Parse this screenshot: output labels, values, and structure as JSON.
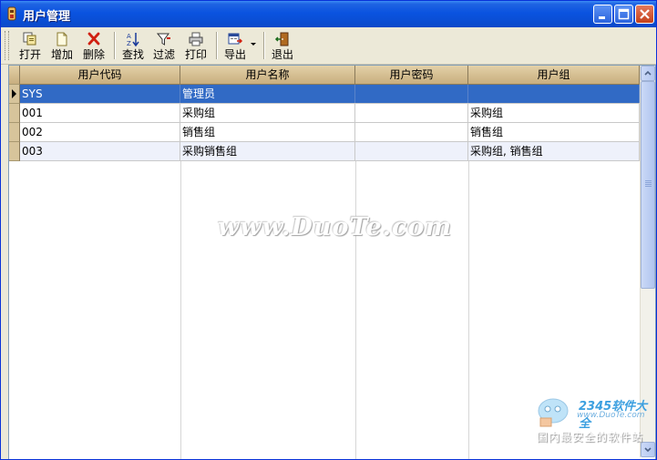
{
  "window": {
    "title": "用户管理"
  },
  "toolbar": {
    "open": "打开",
    "add": "增加",
    "delete": "删除",
    "find": "查找",
    "filter": "过滤",
    "print": "打印",
    "export": "导出",
    "exit": "退出"
  },
  "grid": {
    "columns": [
      "用户代码",
      "用户名称",
      "用户密码",
      "用户组"
    ],
    "rows": [
      {
        "code": "SYS",
        "name": "管理员",
        "password": "",
        "group": ""
      },
      {
        "code": "001",
        "name": "采购组",
        "password": "",
        "group": "采购组"
      },
      {
        "code": "002",
        "name": "销售组",
        "password": "",
        "group": "销售组"
      },
      {
        "code": "003",
        "name": "采购销售组",
        "password": "",
        "group": "采购组, 销售组"
      }
    ]
  },
  "watermark": {
    "text": "www.DuoTe.com"
  },
  "logo": {
    "brand": "2345软件大全",
    "url": "www.DuoTe.com",
    "slogan": "国内最安全的软件站"
  },
  "colors": {
    "selection": "#316AC5",
    "header": "#D7C49B",
    "titlebar": "#0A53E0"
  }
}
